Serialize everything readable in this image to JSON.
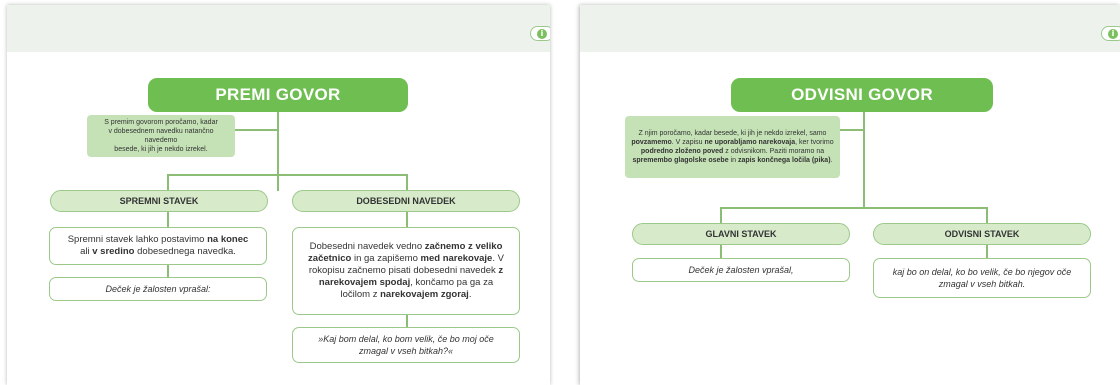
{
  "left": {
    "title": "PREMI GOVOR",
    "note": {
      "l1": "S premim govorom poročamo, kadar",
      "l2": "v dobesednem navedku natančno navedemo",
      "l3": "besede, ki jih je nekdo izrekel."
    },
    "branch_a": {
      "label": "SPREMNI STAVEK",
      "text": {
        "p1": "Spremni stavek lahko postavimo ",
        "b1": "na konec",
        "p2": "ali ",
        "b2": "v sredino",
        "p3": " dobesednega navedka."
      },
      "example": "Deček je žalosten vprašal:"
    },
    "branch_b": {
      "label": "DOBESEDNI NAVEDEK",
      "text": {
        "p1": "Dobesedni navedek vedno ",
        "b1": "začnemo z veliko začetnico",
        "p2": " in ga zapišemo ",
        "b2": "med narekovaje",
        "p3": ". V rokopisu začnemo pisati dobesedni navedek ",
        "b3": "z narekovajem spodaj",
        "p4": ", končamo pa ga za ločilom z ",
        "b4": "narekovajem zgoraj",
        "p5": "."
      },
      "example": "»Kaj bom delal, ko bom velik, če bo moj oče zmagal v vseh bitkah?«"
    }
  },
  "right": {
    "title": "ODVISNI GOVOR",
    "note": {
      "p1": "Z njim poročamo, kadar besede, ki jih je nekdo izrekel, samo ",
      "b1": "povzamemo",
      "p2": ". V zapisu ",
      "b2": "ne uporabljamo narekovaja",
      "p3": ", ker tvorimo ",
      "b3": "podredno zloženo poved",
      "p4": " z odvisnikom. Paziti moramo na ",
      "b4": "spremembo glagolske osebe",
      "p5": " in ",
      "b5": "zapis končnega ločila (pika)",
      "p6": "."
    },
    "branch_a": {
      "label": "GLAVNI STAVEK",
      "example": "Deček je žalosten vprašal,"
    },
    "branch_b": {
      "label": "ODVISNI STAVEK",
      "example": "kaj bo on delal, ko bo velik, če bo njegov oče zmagal v vseh bitkah."
    }
  },
  "icons": {
    "info": "info-icon"
  },
  "colors": {
    "title_green": "#6fbe51",
    "note_green": "#c5e2b6",
    "pill_green": "#d7ebcb",
    "border_green": "#9cc98a",
    "header_bg": "#eef2ec"
  }
}
